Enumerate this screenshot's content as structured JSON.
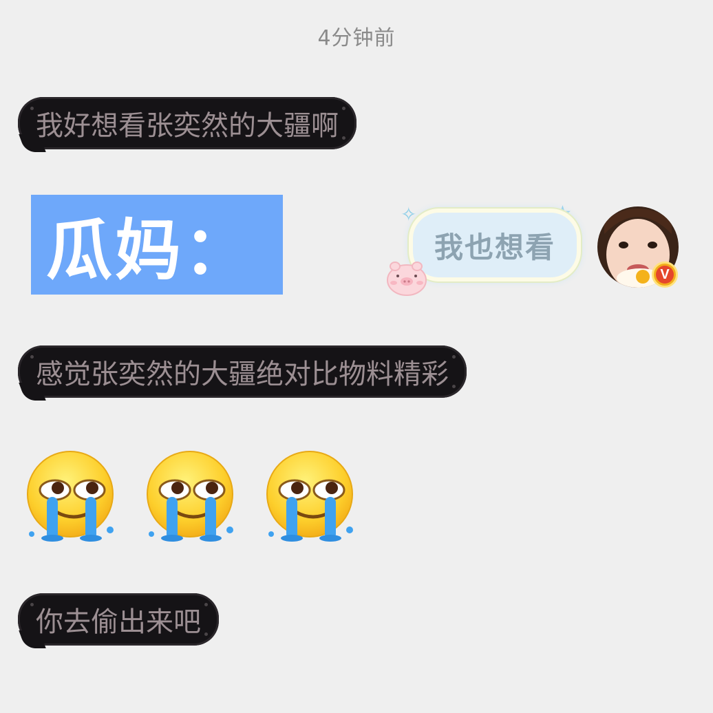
{
  "timestamp": "4分钟前",
  "messages": [
    {
      "text": "我好想看张奕然的大疆啊"
    },
    {
      "text": "感觉张奕然的大疆绝对比物料精彩"
    },
    {
      "text": "你去偷出来吧"
    }
  ],
  "sender_label": "瓜妈：",
  "reply": {
    "text": "我也想看"
  },
  "avatar": {
    "badge": "V"
  },
  "emojis": [
    "crying-face-emoji",
    "crying-face-emoji",
    "crying-face-emoji"
  ],
  "colors": {
    "background": "#efefef",
    "dark_bubble": "#151316",
    "dark_bubble_text": "#9c8f93",
    "label_bg": "#6ea8fa",
    "reply_bubble": "#dfeef8"
  }
}
